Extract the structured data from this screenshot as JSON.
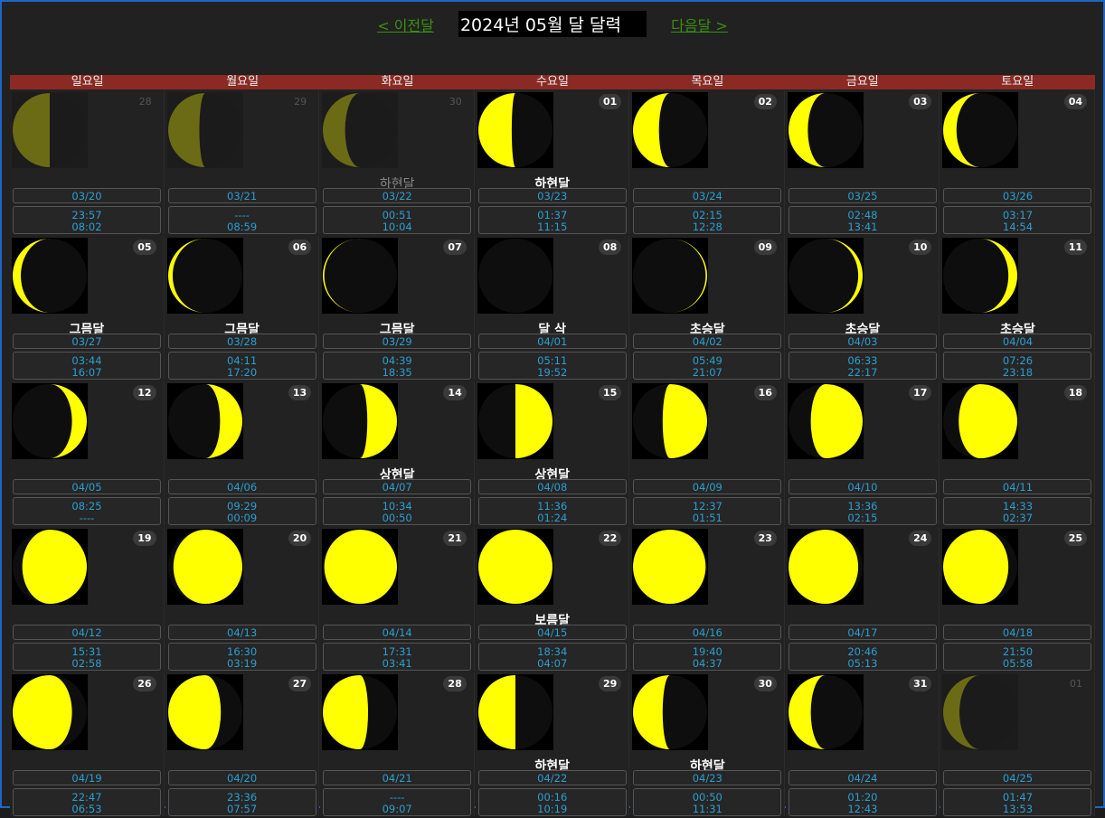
{
  "header": {
    "prev_label": "< 이전달",
    "title": "2024년 05월 달 달력",
    "next_label": "다음달 >"
  },
  "weekdays": [
    "일요일",
    "월요일",
    "화요일",
    "수요일",
    "목요일",
    "금요일",
    "토요일"
  ],
  "colors": {
    "moon_lit": "#ffff00",
    "moon_dark": "#0e0e0e",
    "weekday_bar": "#8b2a24",
    "link": "#3c8f0f",
    "text_blue": "#2b9fd1"
  },
  "days": [
    {
      "day": "28",
      "dim": true,
      "phase_name": "",
      "lunar": "03/20",
      "rise": "23:57",
      "set": "08:02",
      "illum": 0.5,
      "lit": "left"
    },
    {
      "day": "29",
      "dim": true,
      "phase_name": "",
      "lunar": "03/21",
      "rise": "----",
      "set": "08:59",
      "illum": 0.42,
      "lit": "left"
    },
    {
      "day": "30",
      "dim": true,
      "phase_name": "하현달",
      "lunar": "03/22",
      "rise": "00:51",
      "set": "10:04",
      "illum": 0.3,
      "lit": "left"
    },
    {
      "day": "01",
      "dim": false,
      "phase_name": "하현달",
      "lunar": "03/23",
      "rise": "01:37",
      "set": "11:15",
      "illum": 0.45,
      "lit": "left"
    },
    {
      "day": "02",
      "dim": false,
      "phase_name": "",
      "lunar": "03/24",
      "rise": "02:15",
      "set": "12:28",
      "illum": 0.35,
      "lit": "left"
    },
    {
      "day": "03",
      "dim": false,
      "phase_name": "",
      "lunar": "03/25",
      "rise": "02:48",
      "set": "13:41",
      "illum": 0.26,
      "lit": "left"
    },
    {
      "day": "04",
      "dim": false,
      "phase_name": "",
      "lunar": "03/26",
      "rise": "03:17",
      "set": "14:54",
      "illum": 0.18,
      "lit": "left"
    },
    {
      "day": "05",
      "dim": false,
      "phase_name": "그믐달",
      "lunar": "03/27",
      "rise": "03:44",
      "set": "16:07",
      "illum": 0.11,
      "lit": "left"
    },
    {
      "day": "06",
      "dim": false,
      "phase_name": "그믐달",
      "lunar": "03/28",
      "rise": "04:11",
      "set": "17:20",
      "illum": 0.06,
      "lit": "left"
    },
    {
      "day": "07",
      "dim": false,
      "phase_name": "그믐달",
      "lunar": "03/29",
      "rise": "04:39",
      "set": "18:35",
      "illum": 0.02,
      "lit": "left"
    },
    {
      "day": "08",
      "dim": false,
      "phase_name": "달 삭",
      "lunar": "04/01",
      "rise": "05:11",
      "set": "19:52",
      "illum": 0.0,
      "lit": "right"
    },
    {
      "day": "09",
      "dim": false,
      "phase_name": "초승달",
      "lunar": "04/02",
      "rise": "05:49",
      "set": "21:07",
      "illum": 0.02,
      "lit": "right"
    },
    {
      "day": "10",
      "dim": false,
      "phase_name": "초승달",
      "lunar": "04/03",
      "rise": "06:33",
      "set": "22:17",
      "illum": 0.06,
      "lit": "right"
    },
    {
      "day": "11",
      "dim": false,
      "phase_name": "초승달",
      "lunar": "04/04",
      "rise": "07:26",
      "set": "23:18",
      "illum": 0.12,
      "lit": "right"
    },
    {
      "day": "12",
      "dim": false,
      "phase_name": "",
      "lunar": "04/05",
      "rise": "08:25",
      "set": "----",
      "illum": 0.2,
      "lit": "right"
    },
    {
      "day": "13",
      "dim": false,
      "phase_name": "",
      "lunar": "04/06",
      "rise": "09:29",
      "set": "00:09",
      "illum": 0.3,
      "lit": "right"
    },
    {
      "day": "14",
      "dim": false,
      "phase_name": "상현달",
      "lunar": "04/07",
      "rise": "10:34",
      "set": "00:50",
      "illum": 0.4,
      "lit": "right"
    },
    {
      "day": "15",
      "dim": false,
      "phase_name": "상현달",
      "lunar": "04/08",
      "rise": "11:36",
      "set": "01:24",
      "illum": 0.5,
      "lit": "right"
    },
    {
      "day": "16",
      "dim": false,
      "phase_name": "",
      "lunar": "04/09",
      "rise": "12:37",
      "set": "01:51",
      "illum": 0.6,
      "lit": "right"
    },
    {
      "day": "17",
      "dim": false,
      "phase_name": "",
      "lunar": "04/10",
      "rise": "13:36",
      "set": "02:15",
      "illum": 0.7,
      "lit": "right"
    },
    {
      "day": "18",
      "dim": false,
      "phase_name": "",
      "lunar": "04/11",
      "rise": "14:33",
      "set": "02:37",
      "illum": 0.79,
      "lit": "right"
    },
    {
      "day": "19",
      "dim": false,
      "phase_name": "",
      "lunar": "04/12",
      "rise": "15:31",
      "set": "02:58",
      "illum": 0.87,
      "lit": "right"
    },
    {
      "day": "20",
      "dim": false,
      "phase_name": "",
      "lunar": "04/13",
      "rise": "16:30",
      "set": "03:19",
      "illum": 0.93,
      "lit": "right"
    },
    {
      "day": "21",
      "dim": false,
      "phase_name": "",
      "lunar": "04/14",
      "rise": "17:31",
      "set": "03:41",
      "illum": 0.98,
      "lit": "right"
    },
    {
      "day": "22",
      "dim": false,
      "phase_name": "보름달",
      "lunar": "04/15",
      "rise": "18:34",
      "set": "04:07",
      "illum": 1.0,
      "lit": "right"
    },
    {
      "day": "23",
      "dim": false,
      "phase_name": "",
      "lunar": "04/16",
      "rise": "19:40",
      "set": "04:37",
      "illum": 0.98,
      "lit": "left"
    },
    {
      "day": "24",
      "dim": false,
      "phase_name": "",
      "lunar": "04/17",
      "rise": "20:46",
      "set": "05:13",
      "illum": 0.94,
      "lit": "left"
    },
    {
      "day": "25",
      "dim": false,
      "phase_name": "",
      "lunar": "04/18",
      "rise": "21:50",
      "set": "05:58",
      "illum": 0.88,
      "lit": "left"
    },
    {
      "day": "26",
      "dim": false,
      "phase_name": "",
      "lunar": "04/19",
      "rise": "22:47",
      "set": "06:53",
      "illum": 0.8,
      "lit": "left"
    },
    {
      "day": "27",
      "dim": false,
      "phase_name": "",
      "lunar": "04/20",
      "rise": "23:36",
      "set": "07:57",
      "illum": 0.71,
      "lit": "left"
    },
    {
      "day": "28",
      "dim": false,
      "phase_name": "",
      "lunar": "04/21",
      "rise": "----",
      "set": "09:07",
      "illum": 0.61,
      "lit": "left"
    },
    {
      "day": "29",
      "dim": false,
      "phase_name": "하현달",
      "lunar": "04/22",
      "rise": "00:16",
      "set": "10:19",
      "illum": 0.5,
      "lit": "left"
    },
    {
      "day": "30",
      "dim": false,
      "phase_name": "하현달",
      "lunar": "04/23",
      "rise": "00:50",
      "set": "11:31",
      "illum": 0.4,
      "lit": "left"
    },
    {
      "day": "31",
      "dim": false,
      "phase_name": "",
      "lunar": "04/24",
      "rise": "01:20",
      "set": "12:43",
      "illum": 0.3,
      "lit": "left"
    },
    {
      "day": "01",
      "dim": true,
      "phase_name": "",
      "lunar": "04/25",
      "rise": "01:47",
      "set": "13:53",
      "illum": 0.22,
      "lit": "left"
    }
  ]
}
